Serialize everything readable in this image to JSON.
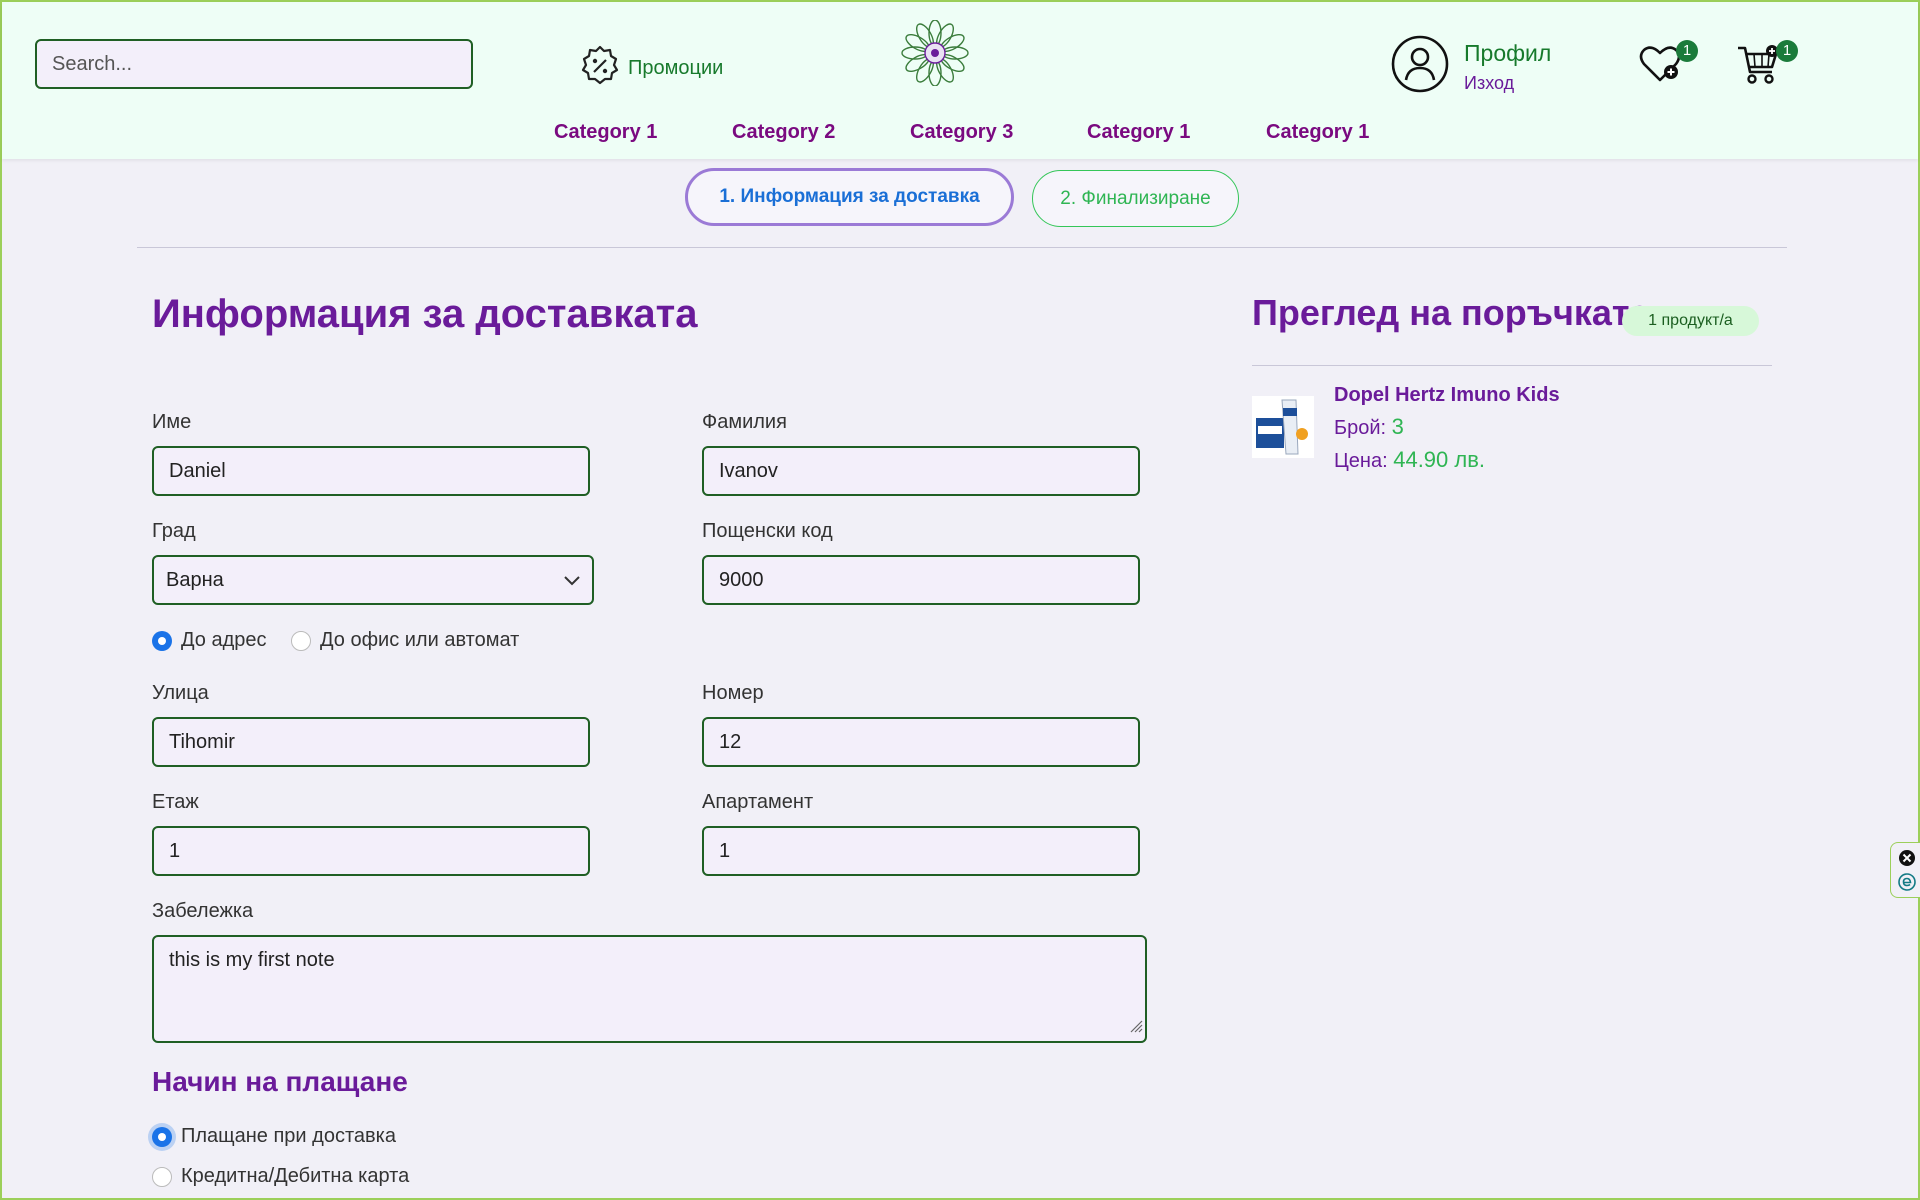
{
  "header": {
    "search_placeholder": "Search...",
    "promo_label": "Промоции",
    "profile_name": "Профил",
    "profile_logout": "Изход",
    "wishlist_count": "1",
    "cart_count": "1"
  },
  "categories": [
    "Category 1",
    "Category 2",
    "Category 3",
    "Category 1",
    "Category 1"
  ],
  "steps": [
    "1. Информация за доставка",
    "2. Финализиране"
  ],
  "form": {
    "title": "Информация за доставката",
    "first_name_label": "Име",
    "first_name_value": "Daniel",
    "last_name_label": "Фамилия",
    "last_name_value": "Ivanov",
    "city_label": "Град",
    "city_value": "Варна",
    "postal_label": "Пощенски код",
    "postal_value": "9000",
    "delivery_options": [
      "До адрес",
      "До офис или автомат"
    ],
    "street_label": "Улица",
    "street_value": "Tihomir",
    "number_label": "Номер",
    "number_value": "12",
    "floor_label": "Етаж",
    "floor_value": "1",
    "apartment_label": "Апартамент",
    "apartment_value": "1",
    "note_label": "Забележка",
    "note_value": "this is my first note",
    "payment_title": "Начин на плащане",
    "payment_options": [
      "Плащане при доставка",
      "Кредитна/Дебитна карта"
    ]
  },
  "summary": {
    "title": "Преглед на поръчката",
    "count_badge": "1 продукт/а",
    "product_name": "Dopel Hertz Imuno Kids",
    "qty_label": "Брой:",
    "qty_value": "3",
    "price_label": "Цена:",
    "price_value": "44.90 лв."
  },
  "colors": {
    "accent_purple": "#6a1b9a",
    "accent_green": "#177a2c",
    "header_bg": "#eefef6",
    "page_bg": "#f1f0f7"
  },
  "icons": [
    "promo-badge-icon",
    "flower-logo-icon",
    "user-icon",
    "wishlist-heart-icon",
    "cart-icon",
    "chevron-down-icon",
    "close-icon",
    "accessibility-icon"
  ]
}
